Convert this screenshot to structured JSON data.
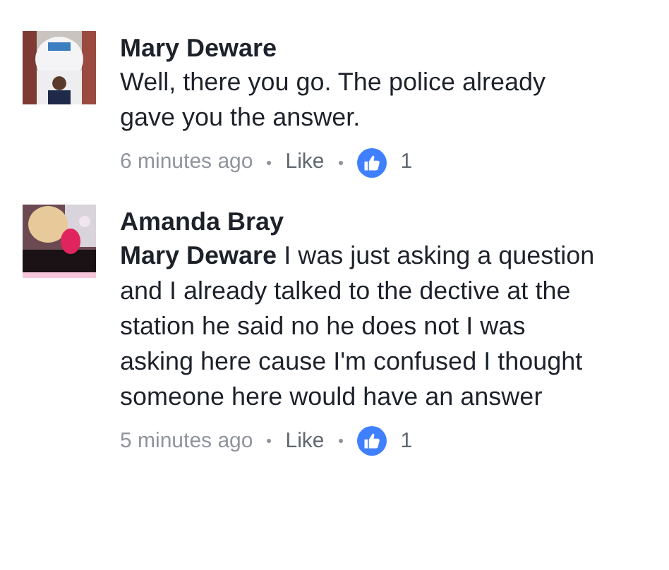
{
  "comments": [
    {
      "author": "Mary Deware",
      "text": "Well, there you go. The police already gave you the answer.",
      "time": "6 minutes ago",
      "like": "Like",
      "reactions": "1"
    },
    {
      "author": "Amanda Bray",
      "text": "**Mary Deware** I was just asking a question and I already talked to the dective at the station he said no he does not I was asking here cause I'm confused I thought someone here would have an answer",
      "time": "5 minutes ago",
      "like": "Like",
      "reactions": "1"
    }
  ]
}
